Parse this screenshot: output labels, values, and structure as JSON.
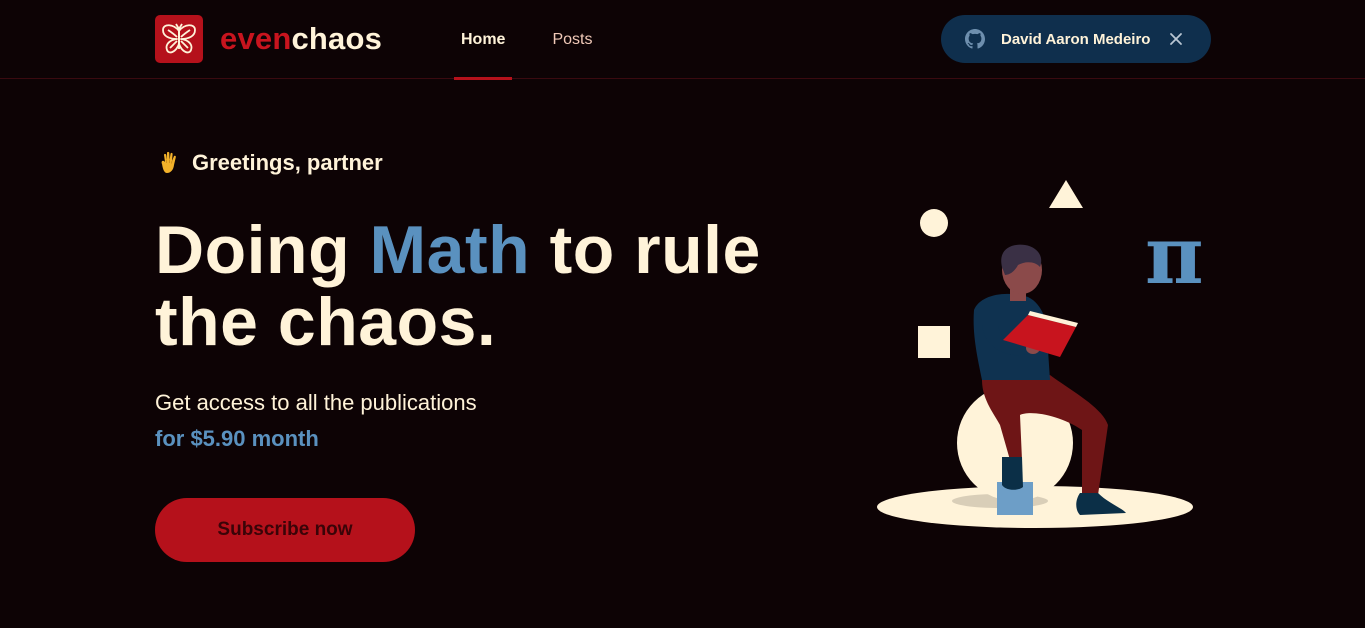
{
  "brand": {
    "name_part1": "even",
    "name_part2": "chaos",
    "logo_icon": "butterfly-icon",
    "colors": {
      "accent_red": "#b5111b",
      "accent_blue": "#5a91bf",
      "cream": "#fff3d9",
      "background": "#0d0305"
    }
  },
  "nav": {
    "items": [
      {
        "label": "Home",
        "active": true
      },
      {
        "label": "Posts",
        "active": false
      }
    ]
  },
  "user": {
    "name": "David Aaron Medeiro",
    "provider_icon": "github-icon",
    "close_icon": "close-icon"
  },
  "hero": {
    "greeting": "Greetings, partner",
    "greeting_icon": "waving-hand-icon",
    "headline_part1": "Doing ",
    "headline_accent": "Math",
    "headline_part2": " to rule the chaos.",
    "subtext": "Get access to all the publications",
    "price": "for $5.90 month",
    "cta_label": "Subscribe now"
  },
  "illustration": {
    "symbol": "π"
  }
}
